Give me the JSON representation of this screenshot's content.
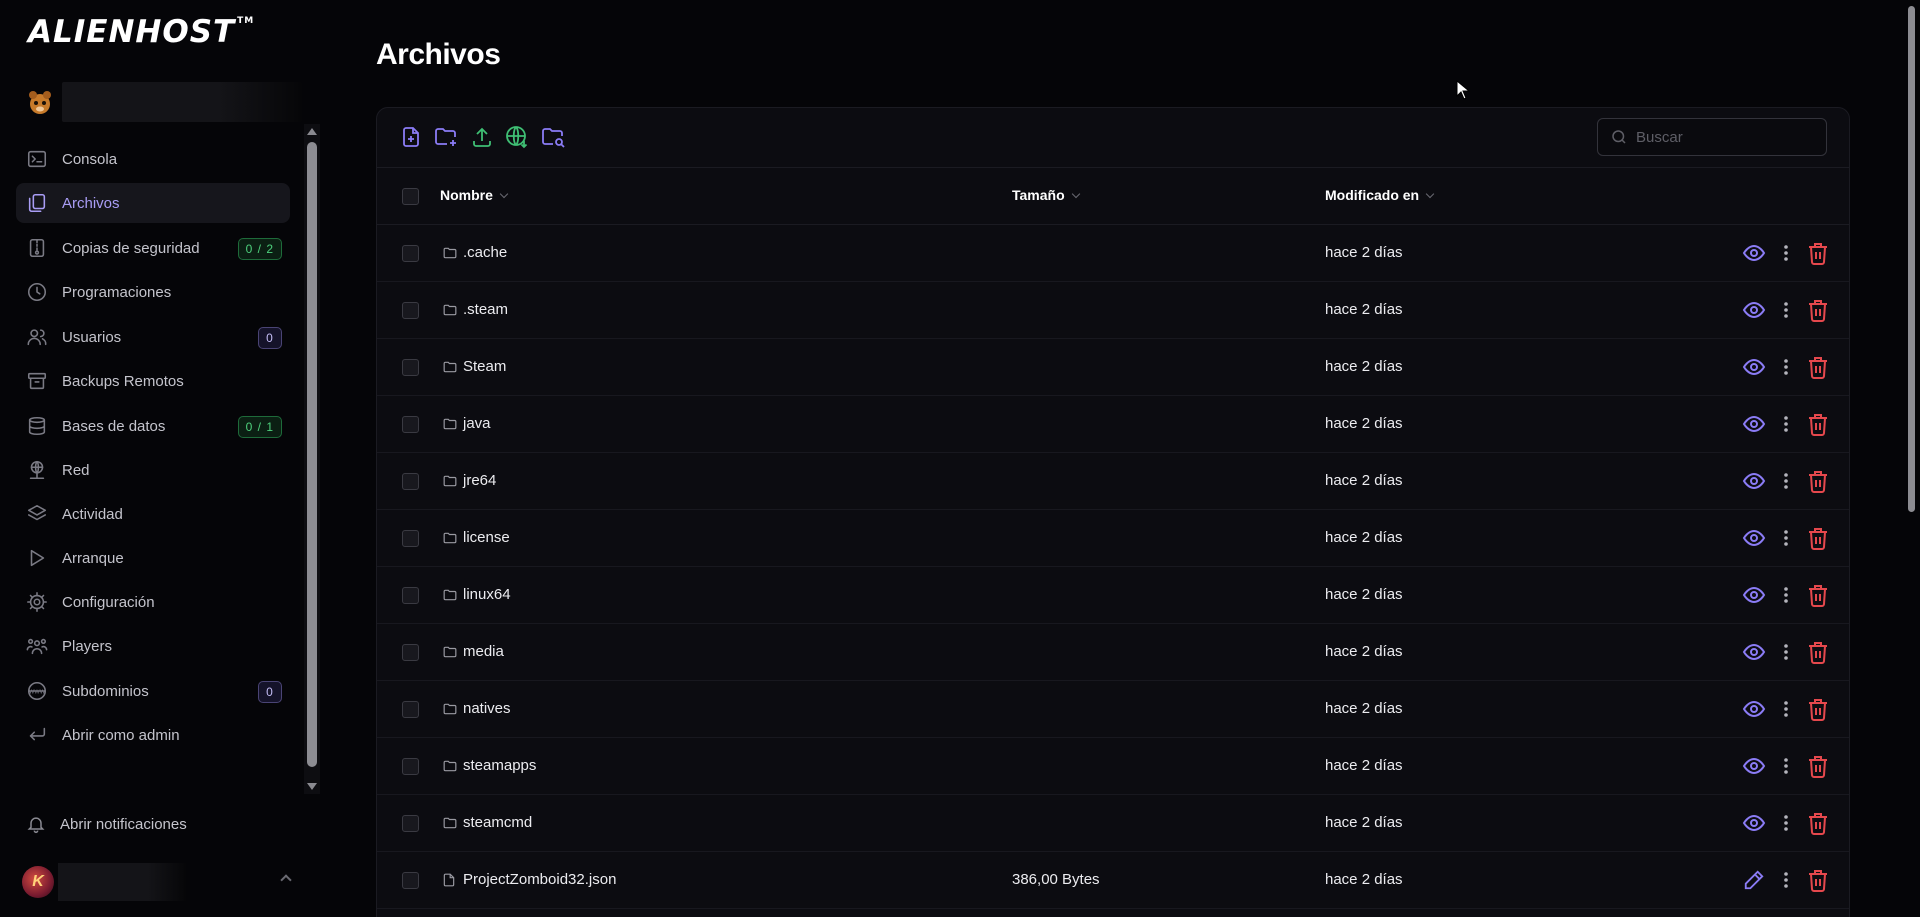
{
  "brand": {
    "name": "ALIENHOST",
    "tm": "TM"
  },
  "colors": {
    "accent": "#8b7cf6",
    "success": "#3fbf74",
    "danger": "#e5484d",
    "background": "#050508"
  },
  "sidebar": {
    "items": [
      {
        "label": "Consola",
        "icon": "terminal-icon",
        "active": false
      },
      {
        "label": "Archivos",
        "icon": "files-icon",
        "active": true
      },
      {
        "label": "Copias de seguridad",
        "icon": "backup-icon",
        "active": false,
        "badge": "0 / 2"
      },
      {
        "label": "Programaciones",
        "icon": "clock-icon",
        "active": false
      },
      {
        "label": "Usuarios",
        "icon": "users-icon",
        "active": false,
        "badge": "0"
      },
      {
        "label": "Backups Remotos",
        "icon": "archive-icon",
        "active": false
      },
      {
        "label": "Bases de datos",
        "icon": "database-icon",
        "active": false,
        "badge": "0 / 1"
      },
      {
        "label": "Red",
        "icon": "network-icon",
        "active": false
      },
      {
        "label": "Actividad",
        "icon": "layers-icon",
        "active": false
      },
      {
        "label": "Arranque",
        "icon": "play-icon",
        "active": false
      },
      {
        "label": "Configuración",
        "icon": "gear-icon",
        "active": false
      },
      {
        "label": "Players",
        "icon": "players-icon",
        "active": false
      },
      {
        "label": "Subdominios",
        "icon": "www-icon",
        "active": false,
        "badge": "0"
      },
      {
        "label": "Abrir como admin",
        "icon": "return-icon",
        "active": false
      }
    ],
    "notifications_label": "Abrir notificaciones"
  },
  "page": {
    "title": "Archivos"
  },
  "toolbar": {
    "tools": [
      "new-file-icon",
      "new-folder-icon",
      "upload-icon",
      "pull-remote-icon",
      "search-folder-icon"
    ],
    "search_placeholder": "Buscar"
  },
  "table": {
    "columns": {
      "name": "Nombre",
      "size": "Tamaño",
      "modified": "Modificado en"
    },
    "rows": [
      {
        "name": ".cache",
        "type": "folder",
        "size": "",
        "modified": "hace 2 días"
      },
      {
        "name": ".steam",
        "type": "folder",
        "size": "",
        "modified": "hace 2 días"
      },
      {
        "name": "Steam",
        "type": "folder",
        "size": "",
        "modified": "hace 2 días"
      },
      {
        "name": "java",
        "type": "folder",
        "size": "",
        "modified": "hace 2 días"
      },
      {
        "name": "jre64",
        "type": "folder",
        "size": "",
        "modified": "hace 2 días"
      },
      {
        "name": "license",
        "type": "folder",
        "size": "",
        "modified": "hace 2 días"
      },
      {
        "name": "linux64",
        "type": "folder",
        "size": "",
        "modified": "hace 2 días"
      },
      {
        "name": "media",
        "type": "folder",
        "size": "",
        "modified": "hace 2 días"
      },
      {
        "name": "natives",
        "type": "folder",
        "size": "",
        "modified": "hace 2 días"
      },
      {
        "name": "steamapps",
        "type": "folder",
        "size": "",
        "modified": "hace 2 días"
      },
      {
        "name": "steamcmd",
        "type": "folder",
        "size": "",
        "modified": "hace 2 días"
      },
      {
        "name": "ProjectZomboid32.json",
        "type": "file",
        "size": "386,00 Bytes",
        "modified": "hace 2 días"
      }
    ]
  }
}
